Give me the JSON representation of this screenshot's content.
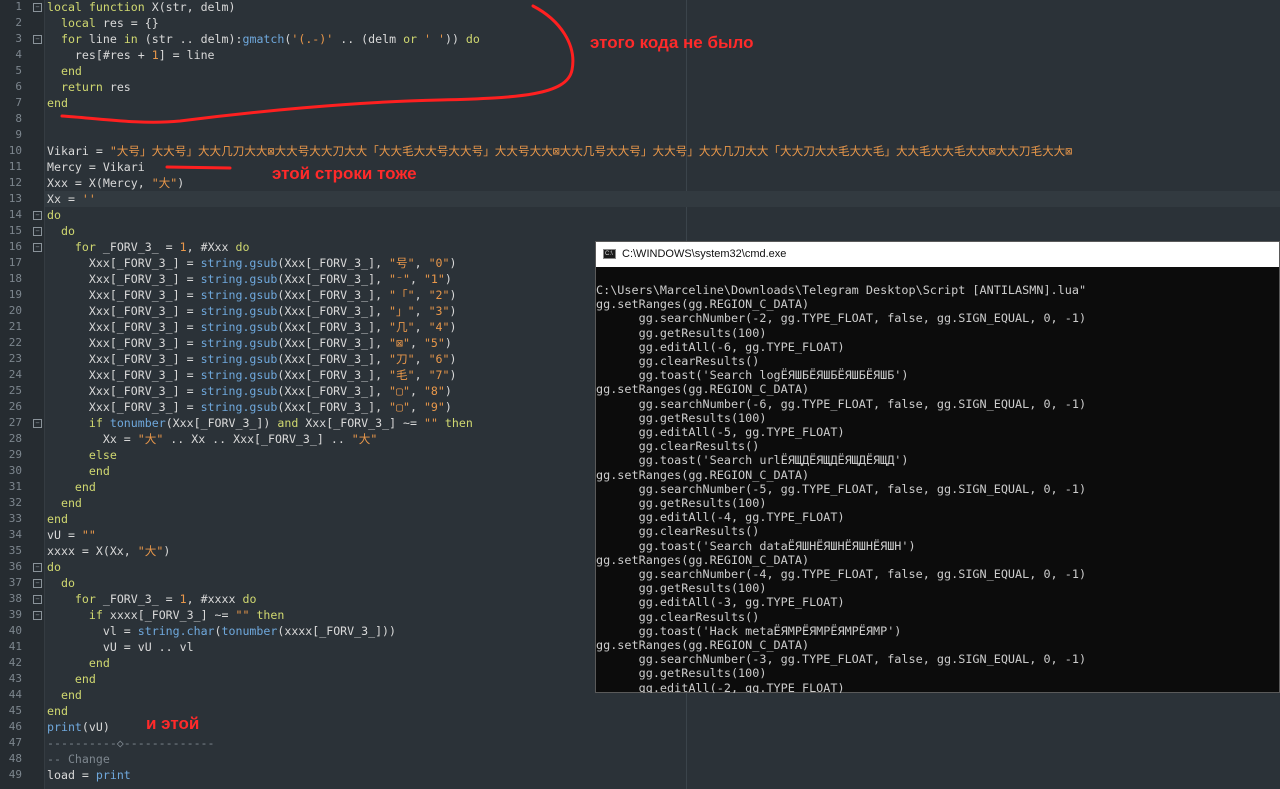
{
  "editor": {
    "lines": [
      {
        "n": "1",
        "fold": "-",
        "html": "<span class='k'>local function</span> X(str, delm)"
      },
      {
        "n": "2",
        "html": "  <span class='k'>local</span> res = {}"
      },
      {
        "n": "3",
        "fold": "-",
        "html": "  <span class='k'>for</span> line <span class='k'>in</span> (str .. delm):<span class='f'>gmatch</span>(<span class='s'>'(.-)'</span> .. (delm <span class='k'>or</span> <span class='s'>' '</span>)) <span class='k'>do</span>"
      },
      {
        "n": "4",
        "html": "    res[#res + <span class='n'>1</span>] = line"
      },
      {
        "n": "5",
        "html": "  <span class='k'>end</span>"
      },
      {
        "n": "6",
        "html": "  <span class='k'>return</span> res"
      },
      {
        "n": "7",
        "html": "<span class='k'>end</span>"
      },
      {
        "n": "8",
        "html": ""
      },
      {
        "n": "9",
        "html": ""
      },
      {
        "n": "10",
        "html": "Vikari = <span class='s'>\"大⁩号」大大⁩号」大大几刀大大⁩⁩⁩⊠大大⁩号⁩大大⁩⁩刀大大⁩「大大⁩毛大大⁩⁩⁩号大大⁩号」大大⁩号⁩大大⁩⁩⊠大大几号大大⁩号」大大⁩号」大大几刀大大⁩「大大刀⁩大大毛⁩大大毛」大大毛⁩大大毛⁩大大⁩⊠大大刀毛大大⁩⊠</span>"
      },
      {
        "n": "11",
        "html": "Mercy = Vikari"
      },
      {
        "n": "12",
        "html": "Xxx = X(Mercy, <span class='s'>\"大\"</span>)"
      },
      {
        "n": "13",
        "cur": true,
        "html": "Xx = <span class='s'>''</span>"
      },
      {
        "n": "14",
        "fold": "-",
        "html": "<span class='k'>do</span>"
      },
      {
        "n": "15",
        "fold": "-",
        "html": "  <span class='k'>do</span>"
      },
      {
        "n": "16",
        "fold": "-",
        "html": "    <span class='k'>for</span> _FORV_3_ = <span class='n'>1</span>, #Xxx <span class='k'>do</span>"
      },
      {
        "n": "17",
        "html": "      Xxx[_FORV_3_] = <span class='f'>string.gsub</span>(Xxx[_FORV_3_], <span class='s'>\"号\"</span>, <span class='s'>\"0\"</span>)"
      },
      {
        "n": "18",
        "html": "      Xxx[_FORV_3_] = <span class='f'>string.gsub</span>(Xxx[_FORV_3_], <span class='s'>\"⁻\"</span>, <span class='s'>\"1\"</span>)"
      },
      {
        "n": "19",
        "html": "      Xxx[_FORV_3_] = <span class='f'>string.gsub</span>(Xxx[_FORV_3_], <span class='s'>\"「\"</span>, <span class='s'>\"2\"</span>)"
      },
      {
        "n": "20",
        "html": "      Xxx[_FORV_3_] = <span class='f'>string.gsub</span>(Xxx[_FORV_3_], <span class='s'>\"」\"</span>, <span class='s'>\"3\"</span>)"
      },
      {
        "n": "21",
        "html": "      Xxx[_FORV_3_] = <span class='f'>string.gsub</span>(Xxx[_FORV_3_], <span class='s'>\"几\"</span>, <span class='s'>\"4\"</span>)"
      },
      {
        "n": "22",
        "html": "      Xxx[_FORV_3_] = <span class='f'>string.gsub</span>(Xxx[_FORV_3_], <span class='s'>\"⊠\"</span>, <span class='s'>\"5\"</span>)"
      },
      {
        "n": "23",
        "html": "      Xxx[_FORV_3_] = <span class='f'>string.gsub</span>(Xxx[_FORV_3_], <span class='s'>\"刀\"</span>, <span class='s'>\"6\"</span>)"
      },
      {
        "n": "24",
        "html": "      Xxx[_FORV_3_] = <span class='f'>string.gsub</span>(Xxx[_FORV_3_], <span class='s'>\"毛\"</span>, <span class='s'>\"7\"</span>)"
      },
      {
        "n": "25",
        "html": "      Xxx[_FORV_3_] = <span class='f'>string.gsub</span>(Xxx[_FORV_3_], <span class='s'>\"▢\"</span>, <span class='s'>\"8\"</span>)"
      },
      {
        "n": "26",
        "html": "      Xxx[_FORV_3_] = <span class='f'>string.gsub</span>(Xxx[_FORV_3_], <span class='s'>\"▢\"</span>, <span class='s'>\"9\"</span>)"
      },
      {
        "n": "27",
        "fold": "-",
        "html": "      <span class='k'>if</span> <span class='f'>tonumber</span>(Xxx[_FORV_3_]) <span class='k'>and</span> Xxx[_FORV_3_] ~= <span class='s'>\"\"</span> <span class='k'>then</span>"
      },
      {
        "n": "28",
        "html": "        Xx = <span class='s'>\"大\"</span> .. Xx .. Xxx[_FORV_3_] .. <span class='s'>\"大\"</span>"
      },
      {
        "n": "29",
        "html": "      <span class='k'>else</span>"
      },
      {
        "n": "30",
        "html": "      <span class='k'>end</span>"
      },
      {
        "n": "31",
        "html": "    <span class='k'>end</span>"
      },
      {
        "n": "32",
        "html": "  <span class='k'>end</span>"
      },
      {
        "n": "33",
        "html": "<span class='k'>end</span>"
      },
      {
        "n": "34",
        "html": "vU = <span class='s'>\"\"</span>"
      },
      {
        "n": "35",
        "html": "xxxx = X(Xx, <span class='s'>\"大\"</span>)"
      },
      {
        "n": "36",
        "fold": "-",
        "html": "<span class='k'>do</span>"
      },
      {
        "n": "37",
        "fold": "-",
        "html": "  <span class='k'>do</span>"
      },
      {
        "n": "38",
        "fold": "-",
        "html": "    <span class='k'>for</span> _FORV_3_ = <span class='n'>1</span>, #xxxx <span class='k'>do</span>"
      },
      {
        "n": "39",
        "fold": "-",
        "html": "      <span class='k'>if</span> xxxx[_FORV_3_] ~= <span class='s'>\"\"</span> <span class='k'>then</span>"
      },
      {
        "n": "40",
        "html": "        vl = <span class='f'>string.char</span>(<span class='f'>tonumber</span>(xxxx[_FORV_3_]))"
      },
      {
        "n": "41",
        "html": "        vU = vU .. vl"
      },
      {
        "n": "42",
        "html": "      <span class='k'>end</span>"
      },
      {
        "n": "43",
        "html": "    <span class='k'>end</span>"
      },
      {
        "n": "44",
        "html": "  <span class='k'>end</span>"
      },
      {
        "n": "45",
        "html": "<span class='k'>end</span>"
      },
      {
        "n": "46",
        "html": "<span class='f'>print</span>(vU)"
      },
      {
        "n": "47",
        "html": "<span class='c'>----------◇-------------</span>"
      },
      {
        "n": "48",
        "html": "<span class='c'>-- Change</span>"
      },
      {
        "n": "49",
        "html": "load = <span class='f'>print</span>"
      }
    ]
  },
  "annotations": {
    "a1": "этого кода не было",
    "a2": "этой строки тоже",
    "a3": "и этой"
  },
  "cmd": {
    "title": "C:\\WINDOWS\\system32\\cmd.exe",
    "icon_label": "C:\\",
    "lines": [
      "C:\\Users\\Marceline\\Downloads\\Telegram Desktop\\Script [ANTILASMN].lua\"",
      "gg.setRanges(gg.REGION_C_DATA)",
      "      gg.searchNumber(-2, gg.TYPE_FLOAT, false, gg.SIGN_EQUAL, 0, -1)",
      "      gg.getResults(100)",
      "      gg.editAll(-6, gg.TYPE_FLOAT)",
      "      gg.clearResults()",
      "      gg.toast('Search logЁЯШБЁЯШБЁЯШБЁЯШБ')",
      "gg.setRanges(gg.REGION_C_DATA)",
      "      gg.searchNumber(-6, gg.TYPE_FLOAT, false, gg.SIGN_EQUAL, 0, -1)",
      "      gg.getResults(100)",
      "      gg.editAll(-5, gg.TYPE_FLOAT)",
      "      gg.clearResults()",
      "      gg.toast('Search urlЁЯЩДЁЯЩДЁЯЩДЁЯЩД')",
      "gg.setRanges(gg.REGION_C_DATA)",
      "      gg.searchNumber(-5, gg.TYPE_FLOAT, false, gg.SIGN_EQUAL, 0, -1)",
      "      gg.getResults(100)",
      "      gg.editAll(-4, gg.TYPE_FLOAT)",
      "      gg.clearResults()",
      "      gg.toast('Search dataЁЯШНЁЯШНЁЯШНЁЯШН')",
      "gg.setRanges(gg.REGION_C_DATA)",
      "      gg.searchNumber(-4, gg.TYPE_FLOAT, false, gg.SIGN_EQUAL, 0, -1)",
      "      gg.getResults(100)",
      "      gg.editAll(-3, gg.TYPE_FLOAT)",
      "      gg.clearResults()",
      "      gg.toast('Hack metaЁЯМРЁЯМРЁЯМРЁЯМР')",
      "gg.setRanges(gg.REGION_C_DATA)",
      "      gg.searchNumber(-3, gg.TYPE_FLOAT, false, gg.SIGN_EQUAL, 0, -1)",
      "      gg.getResults(100)",
      "      gg.editAll(-2, gg.TYPE_FLOAT)"
    ]
  }
}
